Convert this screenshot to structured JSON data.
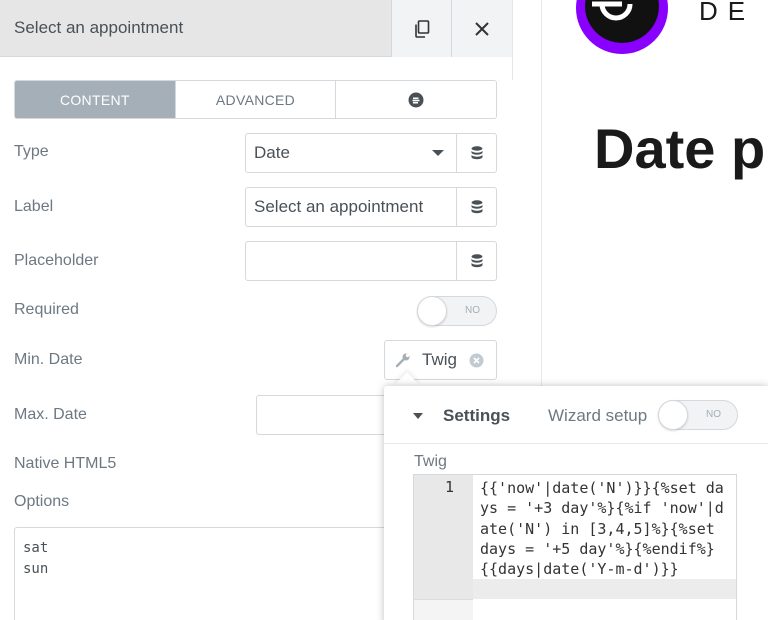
{
  "panel": {
    "title": "Select an appointment",
    "copy_icon": "copy-icon",
    "close_icon": "close-icon"
  },
  "tabs": [
    {
      "label": "CONTENT",
      "active": true
    },
    {
      "label": "ADVANCED",
      "active": false
    },
    {
      "label": "",
      "icon": "elementor-icon",
      "active": false
    }
  ],
  "controls": {
    "type": {
      "label": "Type",
      "value": "Date"
    },
    "label": {
      "label": "Label",
      "value": "Select an appointment"
    },
    "placeholder": {
      "label": "Placeholder",
      "value": ""
    },
    "required": {
      "label": "Required",
      "toggle": "NO"
    },
    "min_date": {
      "label": "Min. Date",
      "tag": "Twig"
    },
    "max_date": {
      "label": "Max. Date"
    },
    "native_html5": {
      "label": "Native HTML5"
    },
    "options": {
      "label": "Options",
      "value": "sat\nsun"
    }
  },
  "popup": {
    "settings_label": "Settings",
    "wizard_label": "Wizard setup",
    "wizard_toggle": "NO",
    "twig_label": "Twig",
    "line_number": "1",
    "code": "{{'now'|date('N')}}{%set days = '+3 day'%}{%if 'now'|date('N') in [3,4,5]%}{%set days = '+5 day'%}{%endif%}{{days|date('Y-m-d')}}"
  },
  "preview": {
    "brand": "DE",
    "heading": "Date p"
  },
  "colors": {
    "accent_purple": "#8a00ff",
    "tab_active": "#a4afb7"
  }
}
